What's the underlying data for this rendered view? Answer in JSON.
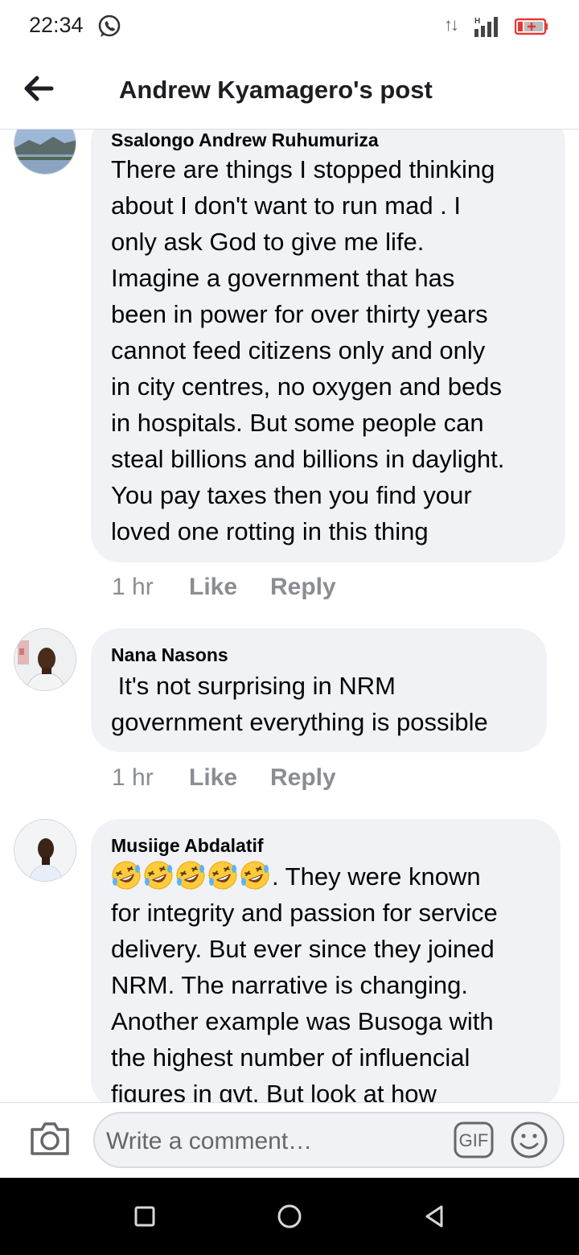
{
  "status_bar": {
    "time": "22:34",
    "network_label": "H",
    "icons": [
      "whatsapp-icon",
      "data-transfer-icon",
      "signal-icon",
      "battery-icon"
    ]
  },
  "header": {
    "title": "Andrew Kyamagero's post",
    "back_icon": "arrow-left-icon"
  },
  "comments": [
    {
      "author": "Ssalongo Andrew Ruhumuriza",
      "lines": [
        "There are things I stopped thinking",
        "about I don't want to run mad . I",
        "only ask God to give me life.",
        "Imagine a government that has",
        "been in power for over thirty years",
        "cannot feed citizens only and only",
        "in city centres, no oxygen and beds",
        "in hospitals. But some people can",
        "steal billions and billions in daylight.",
        "You pay taxes then you find your",
        "loved one rotting in this thing"
      ],
      "time": "1 hr",
      "like": "Like",
      "reply": "Reply"
    },
    {
      "author": "Nana Nasons",
      "lines": [
        " It's not surprising in NRM",
        "government everything is possible"
      ],
      "time": "1 hr",
      "like": "Like",
      "reply": "Reply"
    },
    {
      "author": "Musiige Abdalatif",
      "emoji_count": 5,
      "emoji_name": "rolling-on-floor-laughing-emoji",
      "lines": [
        ". They were known",
        "for integrity and passion for service",
        "delivery. But ever since they joined",
        "NRM. The narrative is changing.",
        "Another example was Busoga with",
        "the highest number of influencial",
        "figures in gvt. But look at how"
      ]
    }
  ],
  "composer": {
    "placeholder": "Write a comment…",
    "gif_label": "GIF",
    "icons": [
      "camera-icon",
      "gif-icon",
      "smiley-icon"
    ]
  },
  "nav_bar": {
    "icons": [
      "recent-apps-icon",
      "home-icon",
      "back-triangle-icon"
    ]
  },
  "colors": {
    "bubble": "#f0f2f5",
    "meta_text": "#8a8d91",
    "header_text": "#1c1e21"
  }
}
